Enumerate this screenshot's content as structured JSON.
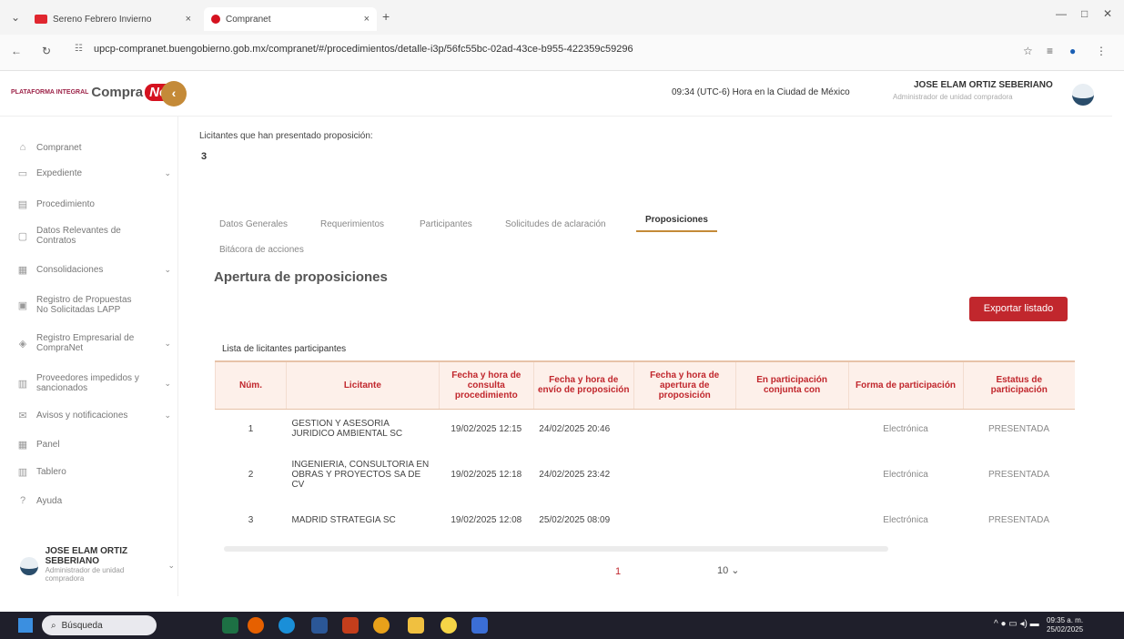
{
  "browser": {
    "tabs": [
      {
        "label": "Sereno Febrero Invierno",
        "close": "×"
      },
      {
        "label": "Compranet",
        "close": "×"
      }
    ],
    "new_tab": "+",
    "url": "upcp-compranet.buengobierno.gob.mx/compranet/#/procedimientos/detalle-i3p/56fc55bc-02ad-43ce-b955-422359c59296"
  },
  "header": {
    "logo_prefix": "PLATAFORMA INTEGRAL",
    "logo_main": "Compra",
    "logo_net": "Net",
    "back": "‹",
    "clock": "09:34 (UTC-6) Hora en la Ciudad de México",
    "user_name": "JOSE ELAM ORTIZ SEBERIANO",
    "user_role": "Administrador de unidad compradora"
  },
  "sidebar": {
    "items": [
      {
        "icon": "⌂",
        "label": "Compranet"
      },
      {
        "icon": "▭",
        "label": "Expediente",
        "chevron": "⌄"
      },
      {
        "icon": "▤",
        "label": "Procedimiento"
      },
      {
        "icon": "▢",
        "label": "Datos Relevantes de Contratos"
      },
      {
        "icon": "▦",
        "label": "Consolidaciones",
        "chevron": "⌄"
      },
      {
        "icon": "▣",
        "label": "Registro de Propuestas No Solicitadas LAPP"
      },
      {
        "icon": "◈",
        "label": "Registro Empresarial de CompraNet",
        "chevron": "⌄"
      },
      {
        "icon": "▥",
        "label": "Proveedores impedidos y sancionados",
        "chevron": "⌄"
      },
      {
        "icon": "✉",
        "label": "Avisos y notificaciones",
        "chevron": "⌄"
      },
      {
        "icon": "▦",
        "label": "Panel"
      },
      {
        "icon": "▥",
        "label": "Tablero"
      },
      {
        "icon": "?",
        "label": "Ayuda"
      }
    ],
    "user_name": "JOSE ELAM ORTIZ SEBERIANO",
    "user_role": "Administrador de unidad compradora"
  },
  "main": {
    "licitantes_label": "Licitantes que han presentado proposición:",
    "licitantes_count": "3",
    "tabs": [
      "Datos Generales",
      "Requerimientos",
      "Participantes",
      "Solicitudes de aclaración",
      "Proposiciones",
      "Bitácora de acciones"
    ],
    "section_title": "Apertura de proposiciones",
    "export_label": "Exportar listado",
    "list_label": "Lista de licitantes participantes",
    "columns": [
      "Núm.",
      "Licitante",
      "Fecha y hora de consulta procedimiento",
      "Fecha y hora de envío de proposición",
      "Fecha y hora de apertura de proposición",
      "En participación conjunta con",
      "Forma de participación",
      "Estatus de participación"
    ],
    "rows": [
      [
        "1",
        "GESTION Y ASESORIA JURIDICO AMBIENTAL SC",
        "19/02/2025 12:15",
        "24/02/2025 20:46",
        "",
        "",
        "Electrónica",
        "PRESENTADA"
      ],
      [
        "2",
        "INGENIERIA, CONSULTORIA EN OBRAS Y PROYECTOS SA DE CV",
        "19/02/2025 12:18",
        "24/02/2025 23:42",
        "",
        "",
        "Electrónica",
        "PRESENTADA"
      ],
      [
        "3",
        "MADRID STRATEGIA SC",
        "19/02/2025 12:08",
        "25/02/2025 08:09",
        "",
        "",
        "Electrónica",
        "PRESENTADA"
      ]
    ],
    "pager_page": "1",
    "pager_size": "10 ⌄"
  },
  "taskbar": {
    "search_placeholder": "Búsqueda",
    "time": "09:35 a. m.",
    "date": "25/02/2025"
  },
  "colors": {
    "accent": "#c1272d",
    "gold": "#c48a38",
    "header_bg": "#fdf0ea"
  }
}
